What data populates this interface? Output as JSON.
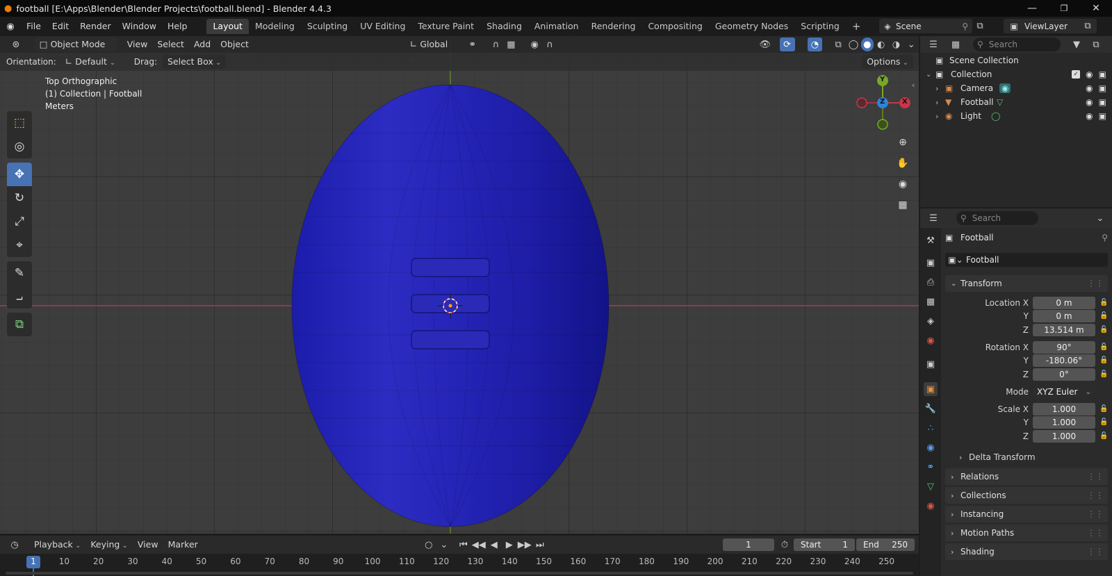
{
  "window": {
    "title": "football [E:\\Apps\\Blender\\Blender Projects\\football.blend] - Blender 4.4.3",
    "minimize": "—",
    "maximize": "❐",
    "close": "✕"
  },
  "menu": [
    "File",
    "Edit",
    "Render",
    "Window",
    "Help"
  ],
  "workspaces": [
    {
      "label": "Layout",
      "active": true
    },
    {
      "label": "Modeling"
    },
    {
      "label": "Sculpting"
    },
    {
      "label": "UV Editing"
    },
    {
      "label": "Texture Paint"
    },
    {
      "label": "Shading"
    },
    {
      "label": "Animation"
    },
    {
      "label": "Rendering"
    },
    {
      "label": "Compositing"
    },
    {
      "label": "Geometry Nodes"
    },
    {
      "label": "Scripting"
    }
  ],
  "add_workspace": "+",
  "scene": {
    "label": "Scene",
    "view_layer": "ViewLayer"
  },
  "viewport": {
    "mode": "Object Mode",
    "menus": [
      "View",
      "Select",
      "Add",
      "Object"
    ],
    "transform_orientation": "Global",
    "orientation_label": "Orientation:",
    "orientation_value": "Default",
    "drag_label": "Drag:",
    "drag_value": "Select Box",
    "options": "Options",
    "info": [
      "Top Orthographic",
      "(1) Collection | Football",
      "Meters"
    ],
    "gizmo": {
      "y": "Y",
      "z": "Z",
      "x": "X"
    },
    "colors": {
      "x_axis": "#c7364a",
      "y_axis": "#78a828",
      "z_axis": "#2f83d6",
      "football": "#2121b5",
      "grid_bg": "#3d3d3d"
    }
  },
  "tools": [
    {
      "icon": "select-box-icon",
      "glyph": "⬚",
      "active": false
    },
    {
      "icon": "cursor-icon",
      "glyph": "◎",
      "active": false
    },
    {
      "icon": "move-icon",
      "glyph": "✥",
      "active": true
    },
    {
      "icon": "rotate-icon",
      "glyph": "↻",
      "active": false
    },
    {
      "icon": "scale-icon",
      "glyph": "⤢",
      "active": false
    },
    {
      "icon": "transform-icon",
      "glyph": "⌖",
      "active": false
    },
    {
      "icon": "annotate-icon",
      "glyph": "✎",
      "active": false
    },
    {
      "icon": "measure-icon",
      "glyph": "⨼",
      "active": false
    },
    {
      "icon": "add-cube-icon",
      "glyph": "⧉",
      "active": false
    }
  ],
  "outliner": {
    "search_placeholder": "Search",
    "root": "Scene Collection",
    "collection": "Collection",
    "items": [
      {
        "name": "Camera",
        "icon_color": "#d98a4a"
      },
      {
        "name": "Football",
        "icon_color": "#d98a4a"
      },
      {
        "name": "Light",
        "icon_color": "#d98a4a"
      }
    ]
  },
  "properties": {
    "search_placeholder": "Search",
    "object_name": "Football",
    "datablock": "Football",
    "transform_title": "Transform",
    "location": {
      "label_x": "Location X",
      "x": "0 m",
      "label_y": "Y",
      "y": "0 m",
      "label_z": "Z",
      "z": "13.514 m"
    },
    "rotation": {
      "label_x": "Rotation X",
      "x": "90°",
      "label_y": "Y",
      "y": "-180.06°",
      "label_z": "Z",
      "z": "0°"
    },
    "mode_label": "Mode",
    "mode_value": "XYZ Euler",
    "scale": {
      "label_x": "Scale X",
      "x": "1.000",
      "label_y": "Y",
      "y": "1.000",
      "label_z": "Z",
      "z": "1.000"
    },
    "delta": "Delta Transform",
    "panels": [
      "Relations",
      "Collections",
      "Instancing",
      "Motion Paths",
      "Shading"
    ]
  },
  "timeline": {
    "menus": [
      "Playback",
      "Keying",
      "View",
      "Marker"
    ],
    "current_frame": "1",
    "start_label": "Start",
    "start": "1",
    "end_label": "End",
    "end": "250",
    "ticks": [
      "1",
      "10",
      "20",
      "30",
      "40",
      "50",
      "60",
      "70",
      "80",
      "90",
      "100",
      "110",
      "120",
      "130",
      "140",
      "150",
      "160",
      "170",
      "180",
      "190",
      "200",
      "210",
      "220",
      "230",
      "240",
      "250"
    ]
  }
}
